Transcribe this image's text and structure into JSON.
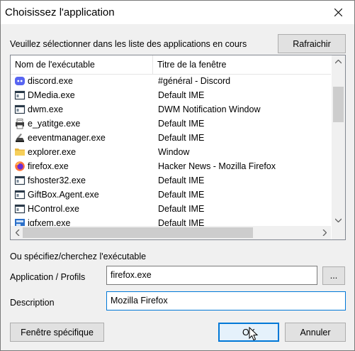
{
  "window": {
    "title": "Choisissez l'application"
  },
  "prompt": "Veuillez sélectionner dans les liste des applications en cours",
  "buttons": {
    "refresh": "Rafraichir",
    "browse": "...",
    "specific_window": "Fenêtre spécifique",
    "ok": "OK",
    "cancel": "Annuler"
  },
  "list": {
    "columns": [
      "Nom de l'exécutable",
      "Titre de la fenêtre"
    ],
    "rows": [
      {
        "exe": "discord.exe",
        "title": "#général - Discord",
        "icon": "discord-icon"
      },
      {
        "exe": "DMedia.exe",
        "title": "Default IME",
        "icon": "window-app-icon"
      },
      {
        "exe": "dwm.exe",
        "title": "DWM Notification Window",
        "icon": "window-app-icon"
      },
      {
        "exe": "e_yatitge.exe",
        "title": "Default IME",
        "icon": "printer-icon"
      },
      {
        "exe": "eeventmanager.exe",
        "title": "Default IME",
        "icon": "scanner-icon"
      },
      {
        "exe": "explorer.exe",
        "title": "Window",
        "icon": "folder-icon"
      },
      {
        "exe": "firefox.exe",
        "title": "Hacker News - Mozilla Firefox",
        "icon": "firefox-icon"
      },
      {
        "exe": "fshoster32.exe",
        "title": "Default IME",
        "icon": "window-app-icon"
      },
      {
        "exe": "GiftBox.Agent.exe",
        "title": "Default IME",
        "icon": "window-app-icon"
      },
      {
        "exe": "HControl.exe",
        "title": "Default IME",
        "icon": "window-app-icon"
      },
      {
        "exe": "igfxem.exe",
        "title": "Default IME",
        "icon": "intel-icon"
      }
    ]
  },
  "specify_label": "Ou spécifiez/cherchez l'exécutable",
  "fields": {
    "app_label": "Application / Profils",
    "app_value": "firefox.exe",
    "desc_label": "Description",
    "desc_value": "Mozilla Firefox"
  }
}
